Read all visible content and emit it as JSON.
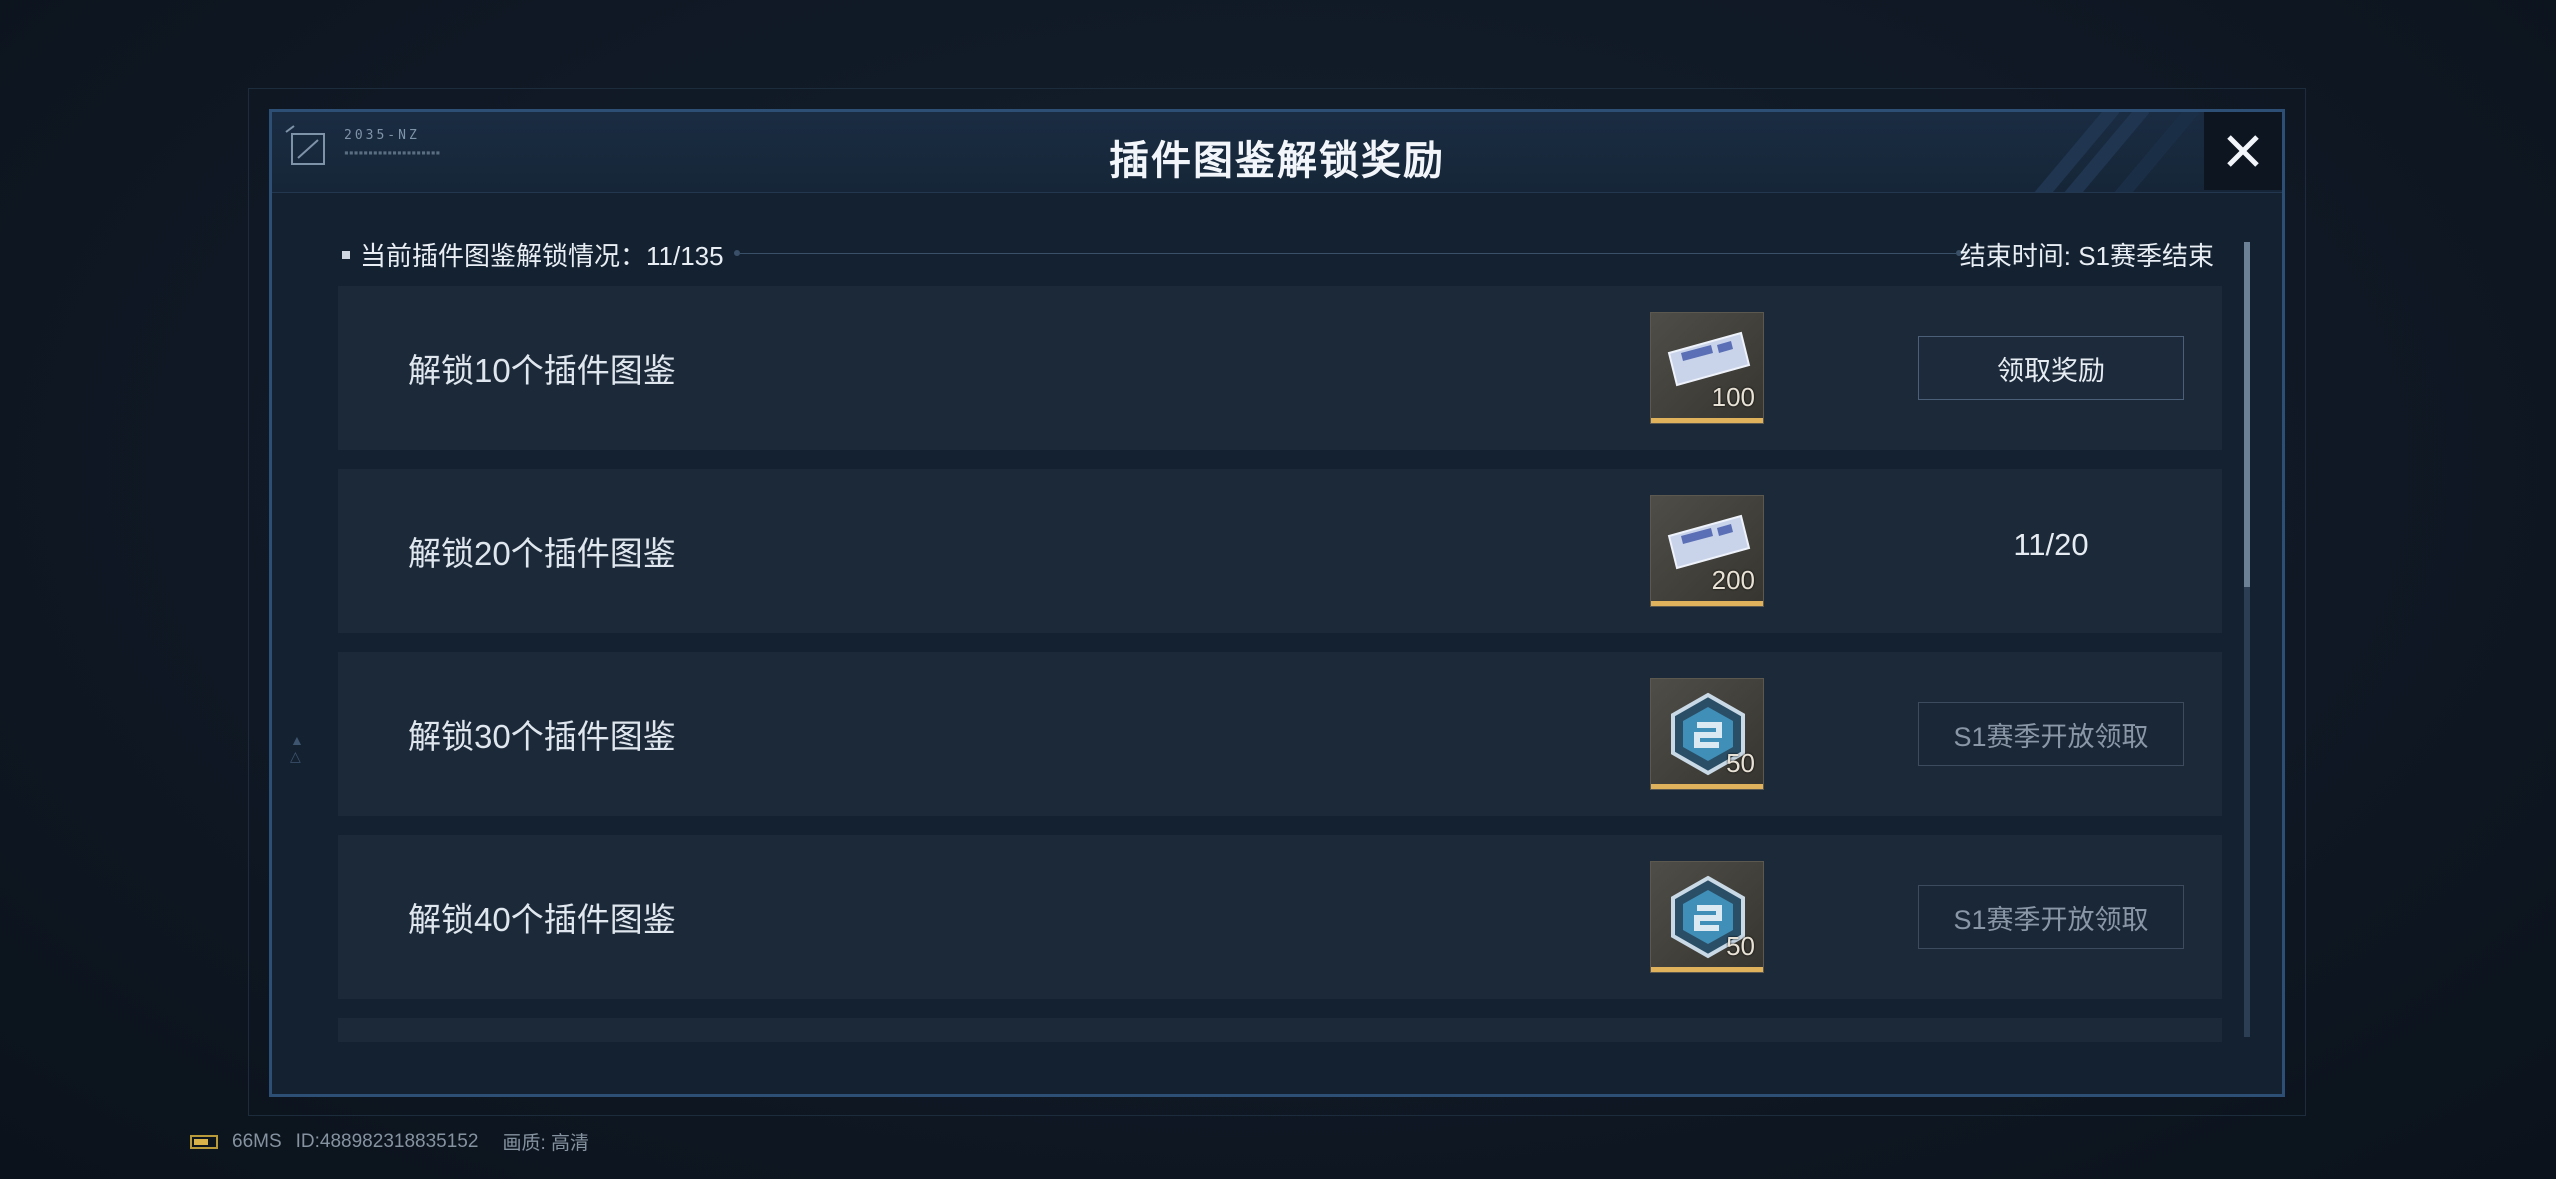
{
  "dialog": {
    "title": "插件图鉴解锁奖励",
    "logo_code": "2035-NZ",
    "summary": "当前插件图鉴解锁情况：11/135",
    "end_time": "结束时间: S1赛季结束"
  },
  "rows": [
    {
      "label": "解锁10个插件图鉴",
      "reward_icon": "ticket-icon",
      "reward_qty": "100",
      "action": "领取奖励",
      "state": "claimable"
    },
    {
      "label": "解锁20个插件图鉴",
      "reward_icon": "ticket-icon",
      "reward_qty": "200",
      "progress": "11/20",
      "state": "in-progress"
    },
    {
      "label": "解锁30个插件图鉴",
      "reward_icon": "hex-coin-icon",
      "reward_qty": "50",
      "action": "S1赛季开放领取",
      "state": "locked"
    },
    {
      "label": "解锁40个插件图鉴",
      "reward_icon": "hex-coin-icon",
      "reward_qty": "50",
      "action": "S1赛季开放领取",
      "state": "locked"
    }
  ],
  "status_bar": {
    "ping": "66MS",
    "id": "ID:488982318835152",
    "quality": "画质:  高清"
  },
  "colors": {
    "accent_gold": "#e0b25b",
    "panel_border": "#2d4f76"
  }
}
